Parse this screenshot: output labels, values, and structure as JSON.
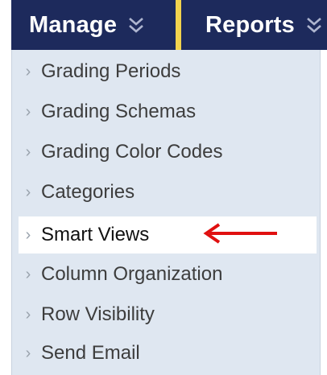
{
  "nav": {
    "tabs": [
      {
        "label": "Manage",
        "icon": "double-chevron-down-icon"
      },
      {
        "label": "Reports",
        "icon": "double-chevron-down-icon"
      }
    ],
    "bar_color": "#1d2a5c",
    "separator_color": "#f2d34e"
  },
  "menu": {
    "items": [
      {
        "label": "Grading Periods"
      },
      {
        "label": "Grading Schemas"
      },
      {
        "label": "Grading Color Codes"
      },
      {
        "label": "Categories"
      },
      {
        "label": "Smart Views",
        "highlighted": true
      },
      {
        "label": "Column Organization"
      },
      {
        "label": "Row Visibility"
      },
      {
        "label": "Send Email"
      }
    ],
    "bullet_icon": "chevron-right-icon",
    "background": "#dfe7f1"
  },
  "annotation": {
    "icon": "red-arrow-left-icon",
    "color": "#e01010"
  }
}
